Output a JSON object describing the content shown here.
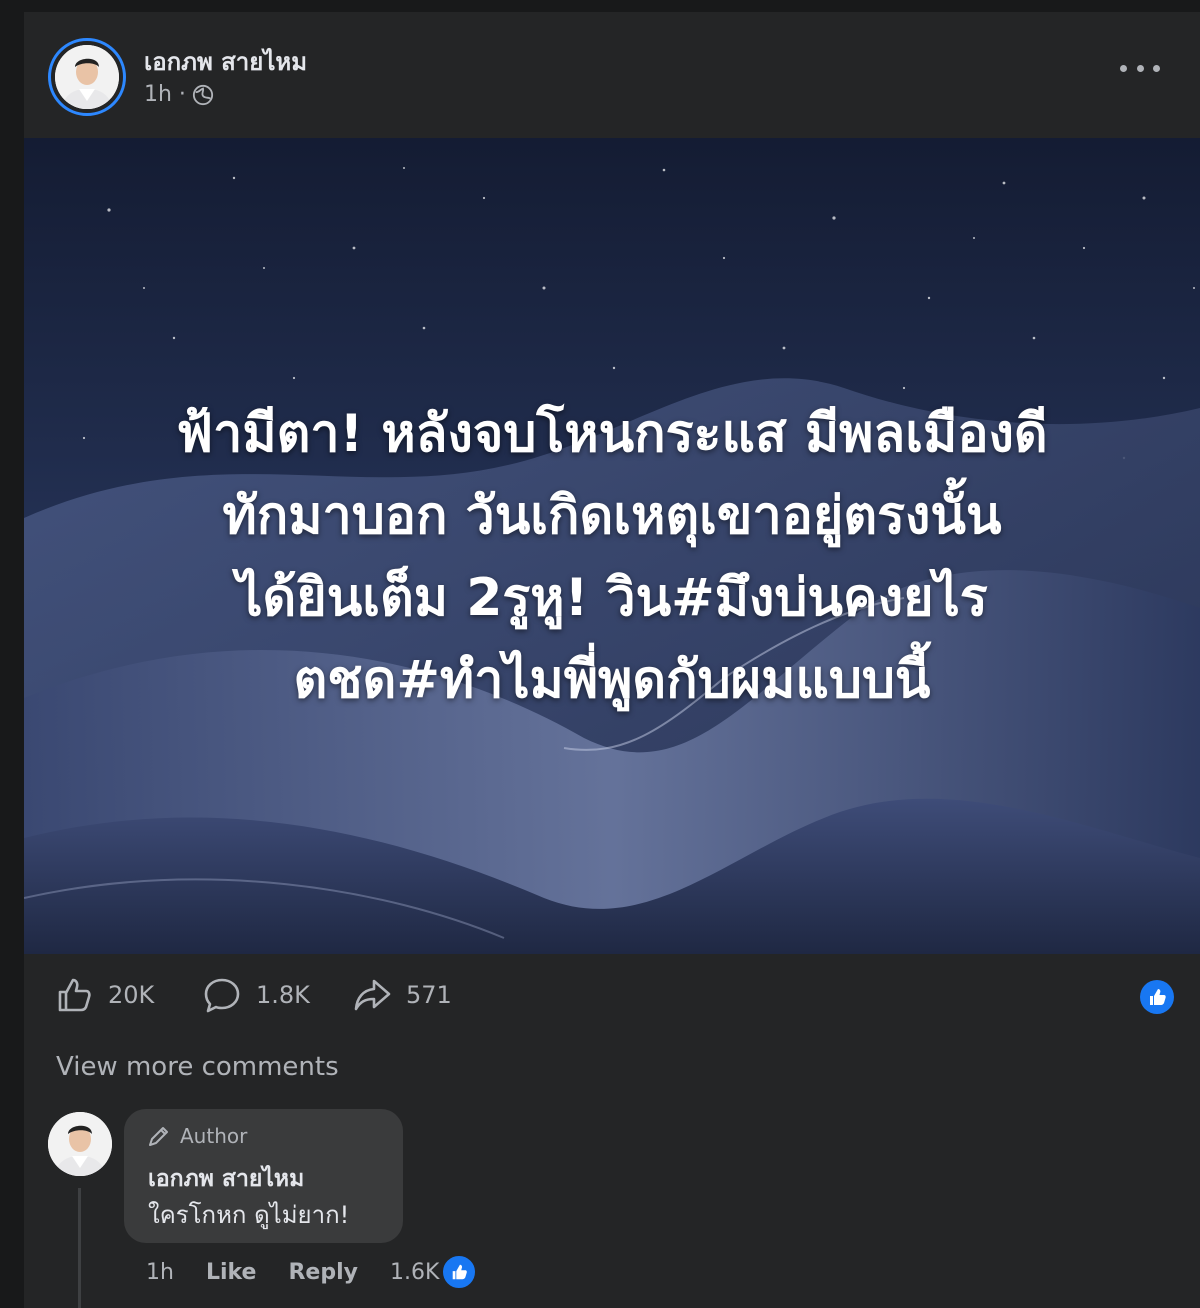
{
  "post": {
    "author": "เอกภพ สายไหม",
    "time": "1h · ",
    "icons": {
      "privacy": "globe-icon",
      "more": "more-options-icon"
    },
    "image_caption_lines": [
      "ฟ้ามีตา! หลังจบโหนกระแส มีพลเมืองดี",
      "ทักมาบอก วันเกิดเหตุเขาอยู่ตรงนั้น",
      "ได้ยินเต็ม 2รูหู! วิน#มึงบ่นคงยไร",
      "ตชด#ทำไมพี่พูดกับผมแบบนี้"
    ],
    "stats": {
      "likes": "20K",
      "comments": "1.8K",
      "shares": "571"
    }
  },
  "comments_section": {
    "view_more": "View more comments",
    "comment": {
      "badge": "Author",
      "name": "เอกภพ สายไหม",
      "text": "ใครโกหก ดูไม่ยาก!",
      "time": "1h",
      "like_label": "Like",
      "reply_label": "Reply",
      "reaction_count": "1.6K"
    }
  },
  "colors": {
    "background": "#18191a",
    "card": "#242526",
    "accent": "#1877f2",
    "text_secondary": "#b0b3b8"
  }
}
